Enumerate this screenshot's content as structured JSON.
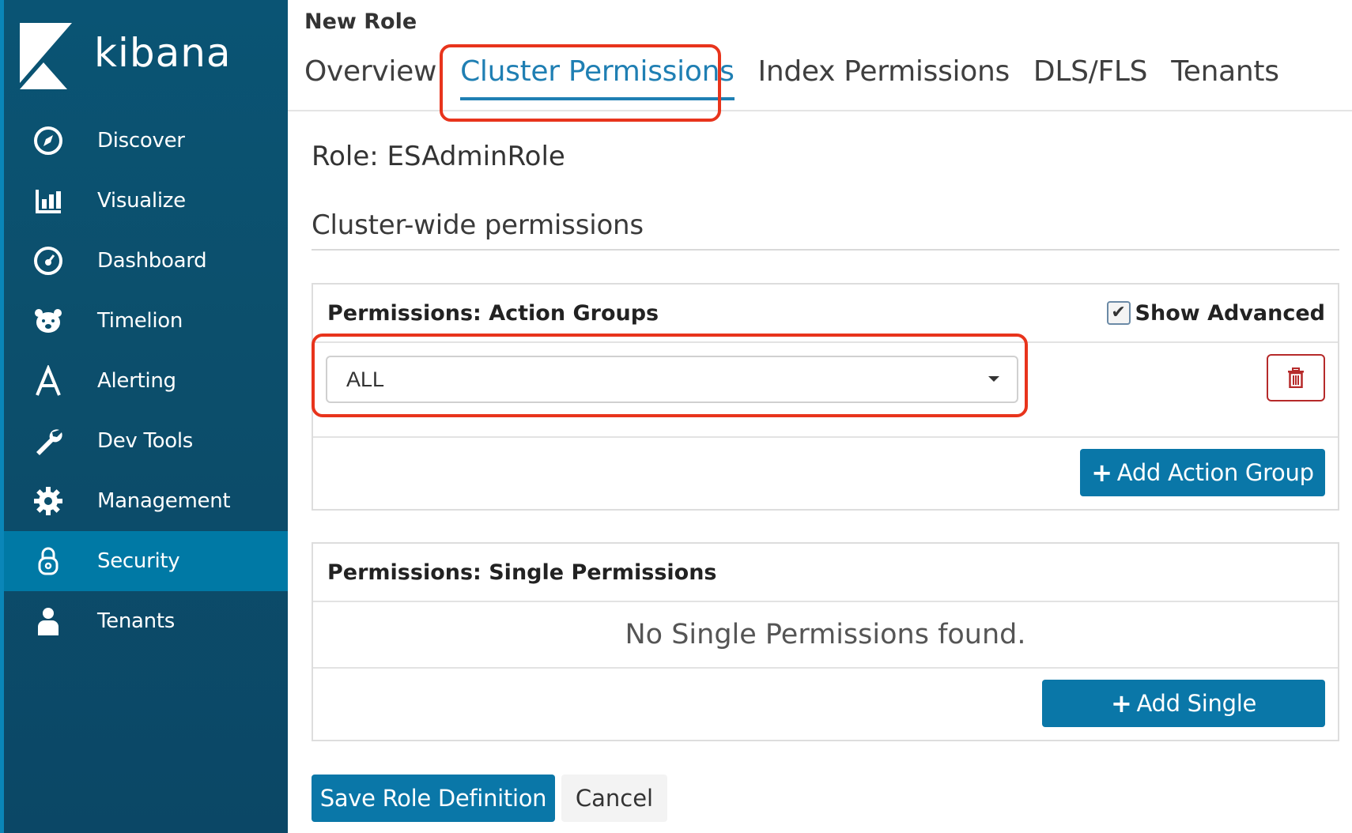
{
  "app": {
    "logo_text": "kibana"
  },
  "sidebar": {
    "items": [
      {
        "label": "Discover",
        "icon": "compass-icon"
      },
      {
        "label": "Visualize",
        "icon": "bar-chart-icon"
      },
      {
        "label": "Dashboard",
        "icon": "dashboard-icon"
      },
      {
        "label": "Timelion",
        "icon": "bear-icon"
      },
      {
        "label": "Alerting",
        "icon": "alerting-icon"
      },
      {
        "label": "Dev Tools",
        "icon": "wrench-icon"
      },
      {
        "label": "Management",
        "icon": "gear-icon"
      },
      {
        "label": "Security",
        "icon": "lock-icon",
        "active": true
      },
      {
        "label": "Tenants",
        "icon": "user-icon"
      }
    ]
  },
  "header": {
    "title": "New Role",
    "tabs": [
      {
        "label": "Overview"
      },
      {
        "label": "Cluster Permissions",
        "active": true
      },
      {
        "label": "Index Permissions"
      },
      {
        "label": "DLS/FLS"
      },
      {
        "label": "Tenants"
      }
    ]
  },
  "content": {
    "role_title": "Role: ESAdminRole",
    "section_title": "Cluster-wide permissions",
    "action_groups": {
      "title": "Permissions: Action Groups",
      "show_advanced_label": "Show Advanced",
      "show_advanced_checked": true,
      "selected_value": "ALL",
      "add_button": "Add Action Group"
    },
    "single_permissions": {
      "title": "Permissions: Single Permissions",
      "empty_message": "No Single Permissions found.",
      "add_button": "Add Single"
    },
    "save_button": "Save Role Definition",
    "cancel_button": "Cancel"
  },
  "colors": {
    "sidebar_bg": "#0b4f6c",
    "active_item": "#0079a5",
    "primary": "#0a77a8",
    "highlight": "#e8341c",
    "danger": "#b62a2a"
  }
}
